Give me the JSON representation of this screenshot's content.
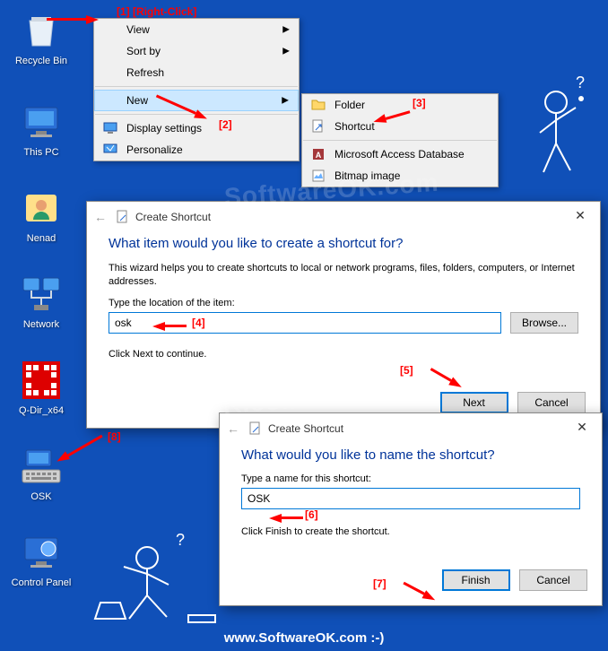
{
  "desktop": {
    "icons": [
      {
        "label": "Recycle Bin"
      },
      {
        "label": "This PC"
      },
      {
        "label": "Nenad"
      },
      {
        "label": "Network"
      },
      {
        "label": "Q-Dir_x64"
      },
      {
        "label": "OSK"
      },
      {
        "label": "Control Panel"
      }
    ]
  },
  "ctx1": {
    "items": [
      {
        "label": "View",
        "sub": true
      },
      {
        "label": "Sort by",
        "sub": true
      },
      {
        "label": "Refresh"
      },
      {
        "label": "New",
        "sub": true,
        "hl": true
      },
      {
        "label": "Display settings"
      },
      {
        "label": "Personalize"
      }
    ]
  },
  "ctx2": {
    "items": [
      {
        "label": "Folder"
      },
      {
        "label": "Shortcut"
      },
      {
        "label": "Microsoft Access Database"
      },
      {
        "label": "Bitmap image"
      }
    ]
  },
  "dlg1": {
    "title": "Create Shortcut",
    "heading": "What item would you like to create a shortcut for?",
    "desc": "This wizard helps you to create shortcuts to local or network programs, files, folders, computers, or Internet addresses.",
    "label": "Type the location of the item:",
    "value": "osk",
    "hint": "Click Next to continue.",
    "browse": "Browse...",
    "next": "Next",
    "cancel": "Cancel"
  },
  "dlg2": {
    "title": "Create Shortcut",
    "heading": "What would you like to name the shortcut?",
    "label": "Type a name for this shortcut:",
    "value": "OSK",
    "hint": "Click Finish to create the shortcut.",
    "finish": "Finish",
    "cancel": "Cancel"
  },
  "ann": {
    "a1": "[1]  [Right-Click]",
    "a2": "[2]",
    "a3": "[3]",
    "a4": "[4]",
    "a5": "[5]",
    "a6": "[6]",
    "a7": "[7]",
    "a8": "[8]"
  },
  "footer": "www.SoftwareOK.com :-)",
  "watermark": "SoftwareOK.com"
}
